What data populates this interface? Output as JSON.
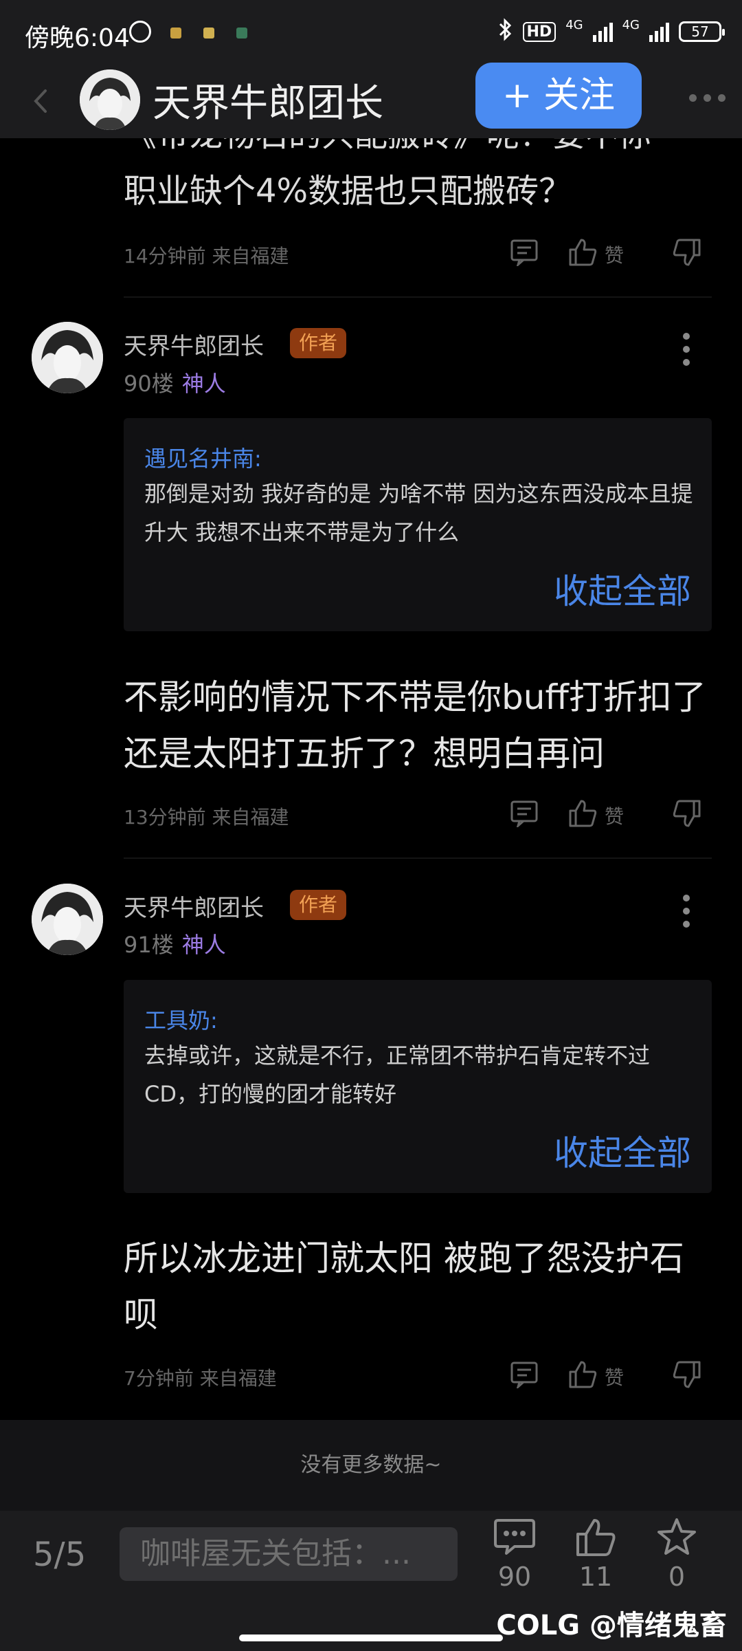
{
  "status_bar": {
    "time": "傍晚6:04",
    "network_1": "4G",
    "network_2": "4G",
    "hd_label": "HD",
    "battery": "57"
  },
  "header": {
    "title": "天界牛郎团长",
    "follow_label": "+ 关注"
  },
  "top_fragment": {
    "line1": "《带龙物石的只配搬砖》呢？要不你",
    "line2": "职业缺个4%数据也只配搬砖？",
    "time": "14分钟前",
    "location": "来自福建",
    "like_label": "赞"
  },
  "posts": [
    {
      "author": "天界牛郎团长",
      "badge": "作者",
      "floor": "90楼",
      "title": "神人",
      "quote_name": "遇见名井南:",
      "quote_text": "那倒是对劲 我好奇的是 为啥不带 因为这东西没成本且提升大 我想不出来不带是为了什么",
      "collapse_label": "收起全部",
      "reply": "不影响的情况下不带是你buff打折扣了还是太阳打五折了？想明白再问",
      "time": "13分钟前",
      "location": "来自福建",
      "like_label": "赞"
    },
    {
      "author": "天界牛郎团长",
      "badge": "作者",
      "floor": "91楼",
      "title": "神人",
      "quote_name": "工具奶:",
      "quote_text": "去掉或许，这就是不行，正常团不带护石肯定转不过CD，打的慢的团才能转好",
      "collapse_label": "收起全部",
      "reply": "所以冰龙进门就太阳 被跑了怨没护石呗",
      "time": "7分钟前",
      "location": "来自福建",
      "like_label": "赞"
    }
  ],
  "no_more": "没有更多数据~",
  "bottom_bar": {
    "page_indicator": "5/5",
    "input_placeholder": "咖啡屋无关包括：...",
    "comments_count": "90",
    "likes_count": "11",
    "favorites_count": "0",
    "watermark": "COLG @情绪鬼畜"
  },
  "colors": {
    "accent_blue": "#4a8bf2",
    "author_badge_bg": "#8e3a10",
    "title_purple": "#9b7be3",
    "background": "#000000"
  },
  "icons": [
    "back-arrow-icon",
    "more-horizontal-icon",
    "comment-icon",
    "thumbs-up-icon",
    "thumbs-down-icon",
    "more-vertical-icon",
    "star-icon"
  ]
}
